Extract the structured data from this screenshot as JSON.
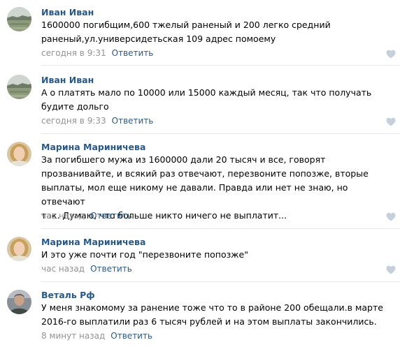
{
  "comments": [
    {
      "author": "Иван Иван",
      "text": "1600000 погибщим,600 тжелый раненый и 200 легко средний\nраненый,ул.универсидетьская 109 адрес помоему",
      "time": "сегодня в 9:31",
      "reply": "Ответить",
      "avatar_icon": "landscape-photo-avatar"
    },
    {
      "author": "Иван Иван",
      "text": "А о платять мало по 10000 или 15000 каждый месяц, так что получать\nбудите дольго",
      "time": "сегодня в 9:33",
      "reply": "Ответить",
      "avatar_icon": "landscape-photo-avatar"
    },
    {
      "author": "Марина Мариничева",
      "text": "За погибшего мужа из 1600000 дали 20 тысяч и все, говорят\nпрозванивайте, и всякий раз отвечают, перезвоните попозже, вторые\nвыплаты, мол еще никому не давали. Правда или нет не знаю, но отвечают\nтак. Думаю, что больше никто ничего не выплатит...",
      "time": "час назад",
      "reply": "Ответить",
      "avatar_icon": "woman-photo-avatar"
    },
    {
      "author": "Марина Мариничева",
      "text": "И это уже почти год \"перезвоните попозже\"",
      "time": "час назад",
      "reply": "Ответить",
      "avatar_icon": "woman-photo-avatar"
    },
    {
      "author": "Веталь Рф",
      "text": "У меня знакомому за ранение тоже что то в районе 200 обещали.в марте\n2016-го выплатили раз 6 тысяч рублей и на этом выплаты закончились.",
      "time": "8 минут назад",
      "reply": "Ответить",
      "avatar_icon": "man-photo-avatar"
    }
  ],
  "colors": {
    "author_link": "#2a5885",
    "meta_gray": "#939393",
    "like_heart": "#c5d0db",
    "divider": "#e7e8ec"
  },
  "icons": {
    "like": "heart-icon"
  }
}
